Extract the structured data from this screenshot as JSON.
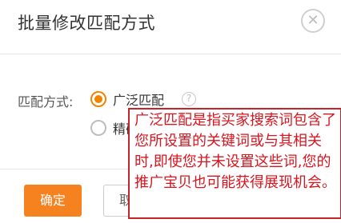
{
  "dialog": {
    "title": "批量修改匹配方式",
    "close_symbol": "✕"
  },
  "form": {
    "label": "匹配方式:",
    "options": [
      {
        "label": "广泛匹配",
        "selected": true
      },
      {
        "label": "精确匹配",
        "selected": false
      }
    ],
    "help_symbol": "?"
  },
  "tooltip": {
    "text": "广泛匹配是指买家搜索词包含了您所设置的关键词或与其相关时,即使您并未设置这些词,您的推广宝贝也可能获得展现机会。"
  },
  "buttons": {
    "confirm_label": "确定",
    "cancel_label": "取消"
  },
  "colors": {
    "accent": "#f5821f",
    "tooltip_border": "#c6242b",
    "tooltip_text": "#d9141e"
  }
}
